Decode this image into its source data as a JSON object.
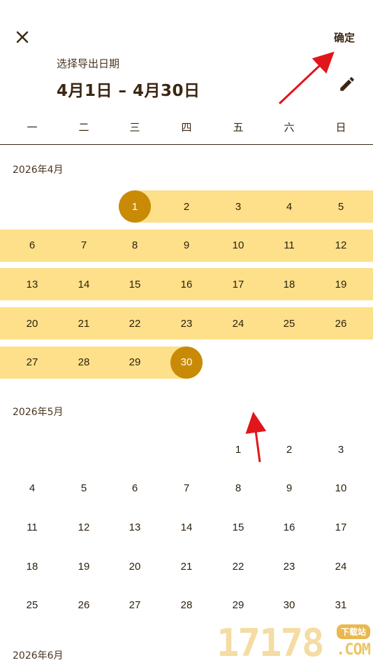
{
  "header": {
    "confirm_label": "确定",
    "subtitle": "选择导出日期",
    "range_title": "4月1日 – 4月30日",
    "close_icon": "close-icon",
    "edit_icon": "pencil-icon"
  },
  "weekdays": [
    "一",
    "二",
    "三",
    "四",
    "五",
    "六",
    "日"
  ],
  "months": [
    {
      "label": "2026年4月",
      "first_weekday": 2,
      "days": 30,
      "range_start": 1,
      "range_end": 30
    },
    {
      "label": "2026年5月",
      "first_weekday": 4,
      "days": 31
    },
    {
      "label": "2026年6月"
    }
  ],
  "colors": {
    "range_fill": "#fde089",
    "endpoint_fill": "#c98a06",
    "text": "#3b2712",
    "annotation_arrow": "#e0161b"
  },
  "watermark": {
    "text": "17178",
    "badge": "下载站",
    "suffix": ".COM"
  }
}
